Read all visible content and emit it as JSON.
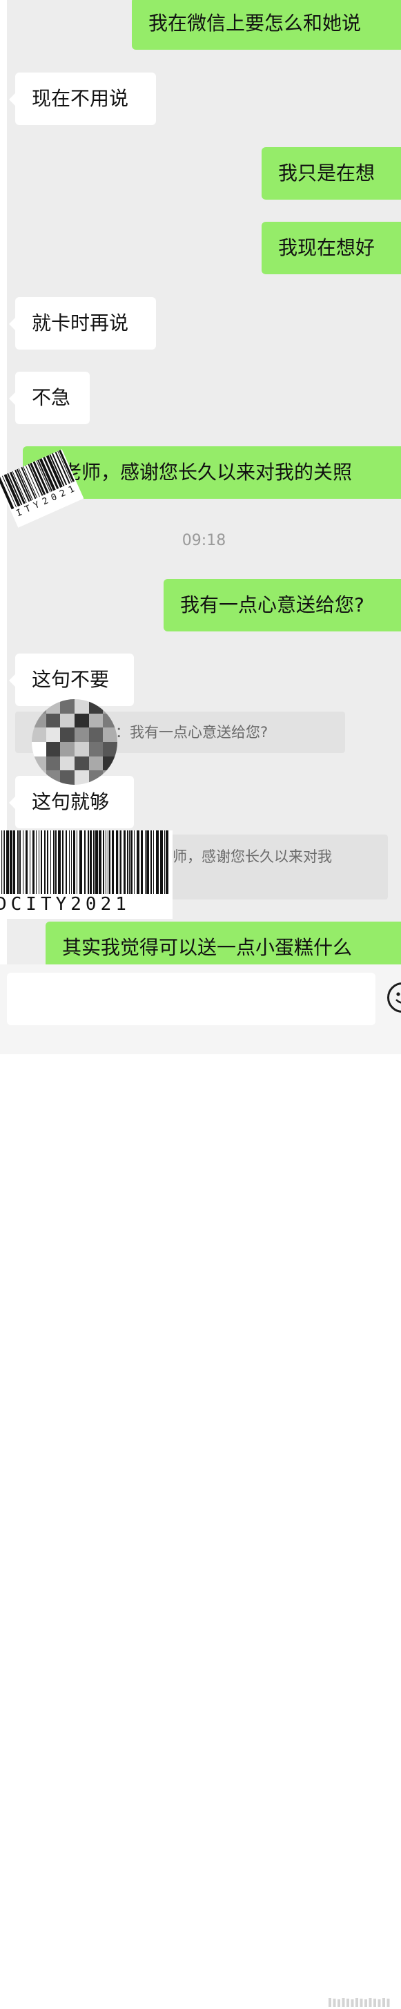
{
  "timestamp": "09:18",
  "messages": [
    {
      "id": "m1",
      "side": "out",
      "text": "我在微信上要怎么和她说"
    },
    {
      "id": "m2",
      "side": "in",
      "text": "现在不用说"
    },
    {
      "id": "m3",
      "side": "out",
      "text": "我只是在想"
    },
    {
      "id": "m4",
      "side": "out",
      "text": "我现在想好"
    },
    {
      "id": "m5",
      "side": "in",
      "text": "就卡时再说"
    },
    {
      "id": "m6",
      "side": "in",
      "text": "不急"
    },
    {
      "id": "m7",
      "side": "out",
      "text": "老师，感谢您长久以来对我的关照"
    },
    {
      "id": "m8",
      "side": "out",
      "text": "我有一点心意送给您?"
    },
    {
      "id": "m9",
      "side": "in",
      "text": "这句不要"
    },
    {
      "id": "m10",
      "side": "in",
      "text": "这句就够"
    },
    {
      "id": "m11",
      "side": "out",
      "text": "其实我觉得可以送一点小蛋糕什么"
    }
  ],
  "quotes": {
    "q1": "：我有一点心意送给您?",
    "q2": "师，感谢您长久以来对我"
  },
  "stickers": {
    "barcode_small": "ITY2021",
    "barcode_large": "DCITY2021"
  },
  "input": {
    "value": "",
    "placeholder": ""
  },
  "icons": {
    "emoji": "emoji-face-icon"
  },
  "colors": {
    "outgoing_bubble": "#95ec69",
    "incoming_bubble": "#ffffff",
    "chat_background": "#ededed",
    "quote_background": "#e2e2e2",
    "timestamp_text": "#9a9a9a"
  }
}
